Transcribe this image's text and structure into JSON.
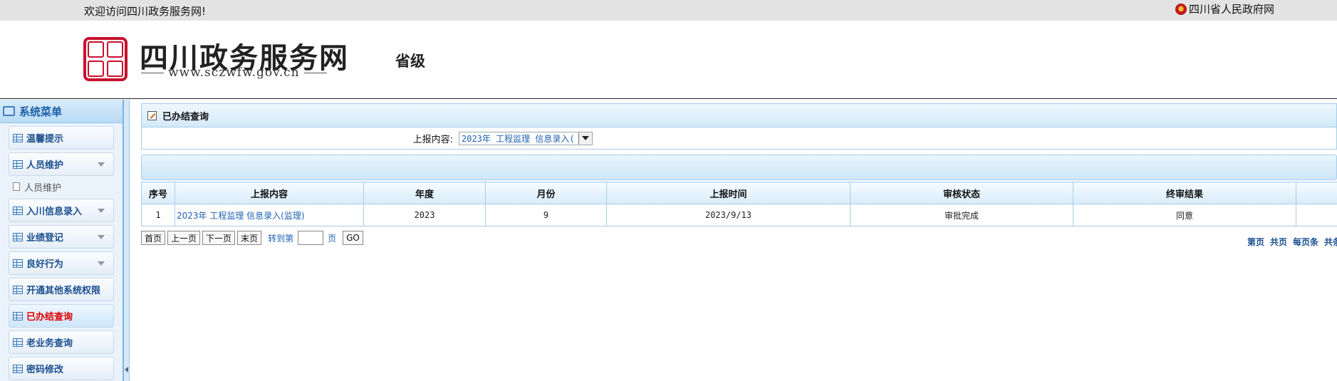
{
  "topbar": {
    "welcome": "欢迎访问四川政务服务网!",
    "gov_link": "四川省人民政府网"
  },
  "header": {
    "site_title": "四川政务服务网",
    "site_url": "www.sczwfw.gov.cn",
    "level": "省级"
  },
  "sidebar": {
    "title": "系统菜单",
    "items": [
      {
        "label": "温馨提示"
      },
      {
        "label": "人员维护"
      },
      {
        "label": "入川信息录入"
      },
      {
        "label": "业绩登记"
      },
      {
        "label": "良好行为"
      },
      {
        "label": "开通其他系统权限"
      },
      {
        "label": "已办结查询"
      },
      {
        "label": "老业务查询"
      },
      {
        "label": "密码修改"
      }
    ],
    "sub_items": [
      {
        "label": "人员维护"
      }
    ]
  },
  "main": {
    "panel_title": "已办结查询",
    "filter_label": "上报内容:",
    "filter_value": "2023年 工程监理 信息录入(",
    "table": {
      "headers": [
        "序号",
        "上报内容",
        "年度",
        "月份",
        "上报时间",
        "审核状态",
        "终审结果",
        ""
      ],
      "rows": [
        [
          "1",
          "2023年 工程监理 信息录入(监理)",
          "2023",
          "9",
          "2023/9/13",
          "审批完成",
          "同意",
          ""
        ]
      ]
    },
    "pager": {
      "first": "首页",
      "prev": "上一页",
      "next": "下一页",
      "last": "末页",
      "goto_prefix": "转到第",
      "goto_suffix": "页",
      "go": "GO",
      "right_info": [
        "第页",
        "共页",
        "每页条",
        "共条"
      ]
    }
  },
  "colors": {
    "accent": "#2162b3",
    "active_menu": "#e00000",
    "border": "#a6cde9"
  }
}
